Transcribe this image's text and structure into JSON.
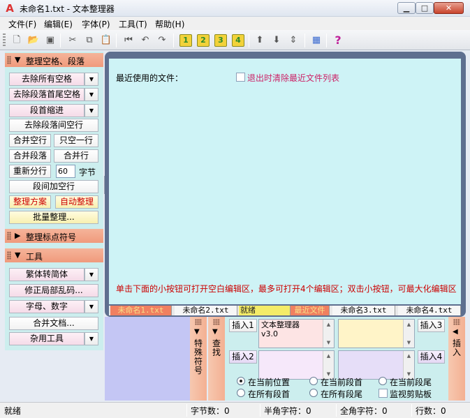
{
  "window": {
    "title": "未命名1.txt - 文本整理器"
  },
  "menu": {
    "file": "文件(F)",
    "edit": "编辑(E)",
    "font": "字体(P)",
    "tools": "工具(T)",
    "help": "帮助(H)"
  },
  "toolbar": {
    "icons": [
      "new-file-icon",
      "open-file-icon",
      "save-icon",
      "cut-icon",
      "copy-icon",
      "paste-icon",
      "first-icon",
      "undo-icon",
      "redo-icon",
      "tab1-icon",
      "tab2-icon",
      "tab3-icon",
      "tab4-icon",
      "move-up-icon",
      "move-down-icon",
      "move-updown-icon",
      "palette-icon",
      "help-icon"
    ],
    "tab_labels": [
      "1",
      "2",
      "3",
      "4"
    ]
  },
  "left": {
    "section1": "整理空格、段落",
    "remove_all_spaces": "去除所有空格",
    "remove_edge_spaces": "去除段落首尾空格",
    "indent": "段首缩进",
    "remove_blank_lines": "去除段落间空行",
    "merge_blank": "合并空行",
    "only_one_blank": "只空一行",
    "merge_paragraph": "合并段落",
    "merge_line": "合并行",
    "rewrap": "重新分行",
    "rewrap_value": "60",
    "bytes_unit": "字节",
    "add_blank_between": "段间加空行",
    "scheme": "整理方案",
    "auto_arrange": "自动整理",
    "batch": "批量整理...",
    "section2": "整理标点符号",
    "section3": "工具",
    "trad_to_simp": "繁体转简体",
    "fix_garbled": "修正局部乱码...",
    "letters_digits": "字母、数字",
    "merge_docs": "合并文档...",
    "misc_tools": "杂用工具"
  },
  "editor": {
    "recent_files": "最近使用的文件：",
    "clear_on_exit": "退出时清除最近文件列表",
    "hint": "单击下面的小按钮可打开空白编辑区，最多可打开4个编辑区；双击小按钮，可最大化编辑区"
  },
  "tabs": {
    "tab1": "未命名1.txt",
    "tab2": "未命名2.txt",
    "status": "就绪",
    "recent": "最近文件",
    "tab3": "未命名3.txt",
    "tab4": "未命名4.txt"
  },
  "bottom": {
    "special_symbols": "特殊符号",
    "find": "查找",
    "insert1": "插入1",
    "insert2": "插入2",
    "insert3": "插入3",
    "insert4": "插入4",
    "text1_line1": "文本整理器",
    "text1_line2": "v3.0",
    "insert_side": "插入",
    "opt_cursor": "在当前位置",
    "opt_para_start": "在当前段首",
    "opt_para_end": "在当前段尾",
    "opt_all_start": "在所有段首",
    "opt_all_end": "在所有段尾",
    "opt_clipboard": "监视剪贴板"
  },
  "status": {
    "ready": "就绪",
    "bytes": "字节数：0",
    "half": "半角字符：0",
    "full": "全角字符：0",
    "lines": "行数：0"
  },
  "colors": {
    "accent": "#f09a7c",
    "panel": "#cceeee",
    "editor_bg": "#cef3f6",
    "hint_red": "#cc0000"
  }
}
